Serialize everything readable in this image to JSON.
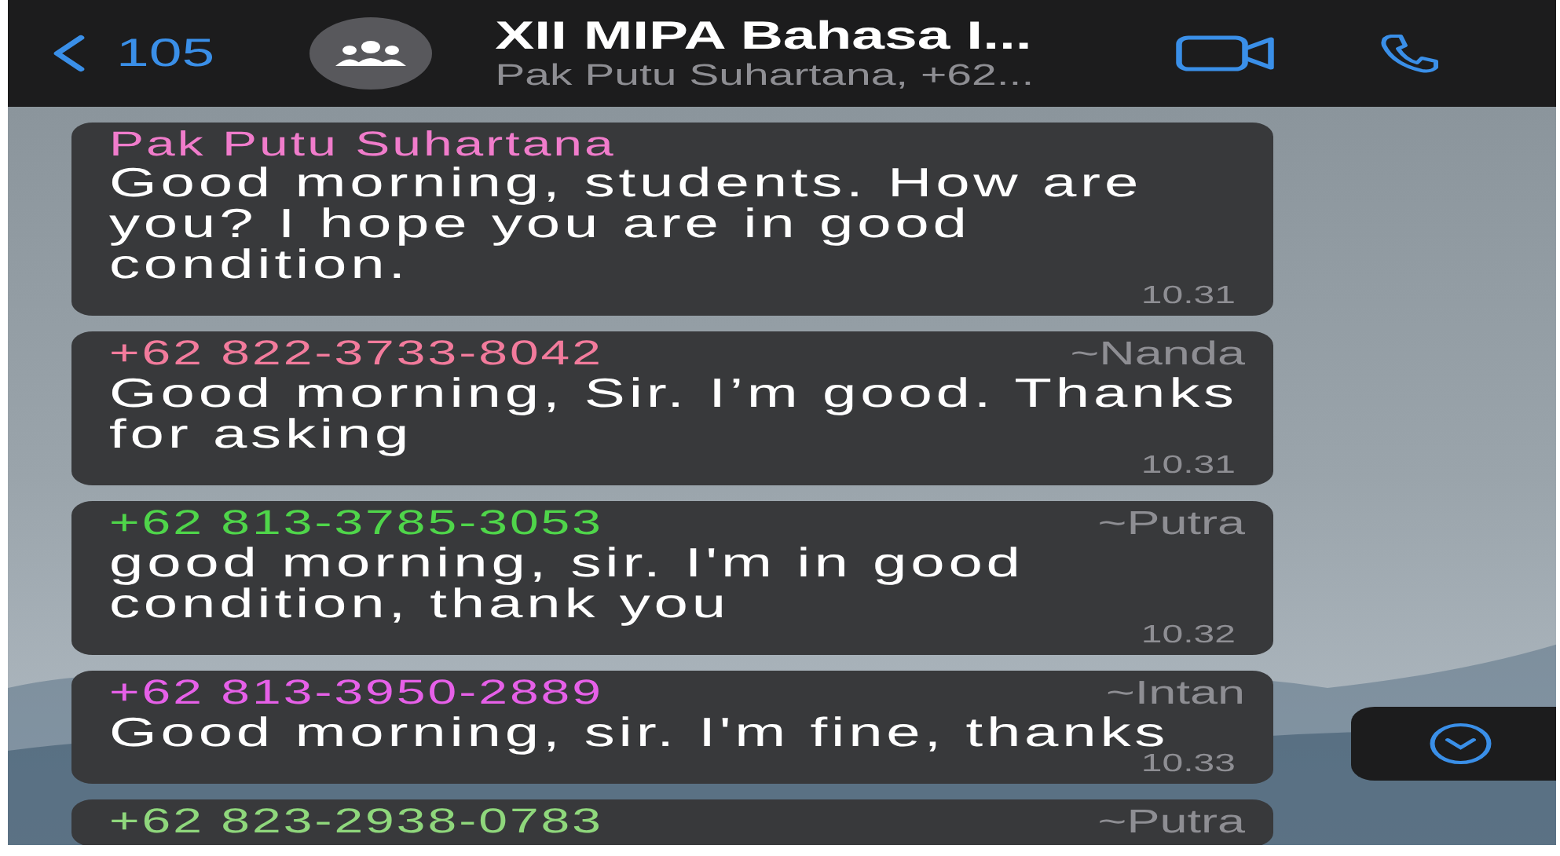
{
  "header": {
    "back_label": "105",
    "title": "XII MIPA Bahasa I...",
    "subtitle": "Pak Putu Suhartana, +62..."
  },
  "messages": [
    {
      "sender": "Pak Putu Suhartana",
      "color": "#f07ccb",
      "text": "Good morning, students. How are you? I hope you are in good condition.",
      "time": "10.31"
    },
    {
      "sender": "+62 822-3733-8042",
      "color": "#f27b9c",
      "alias": "~Nanda",
      "text": "Good morning, Sir. I’m good. Thanks for asking",
      "time": "10.31"
    },
    {
      "sender": "+62 813-3785-3053",
      "color": "#4fd54a",
      "alias": "~Putra",
      "text": "good morning, sir. I'm in good condition, thank you",
      "time": "10.32"
    },
    {
      "sender": "+62 813-3950-2889",
      "color": "#e660e8",
      "alias": "~Intan",
      "text": "Good morning, sir. I'm fine, thanks",
      "time": "10.33"
    },
    {
      "sender": "+62 823-2938-0783",
      "color": "#8fd77c",
      "alias": "~Putra"
    }
  ]
}
